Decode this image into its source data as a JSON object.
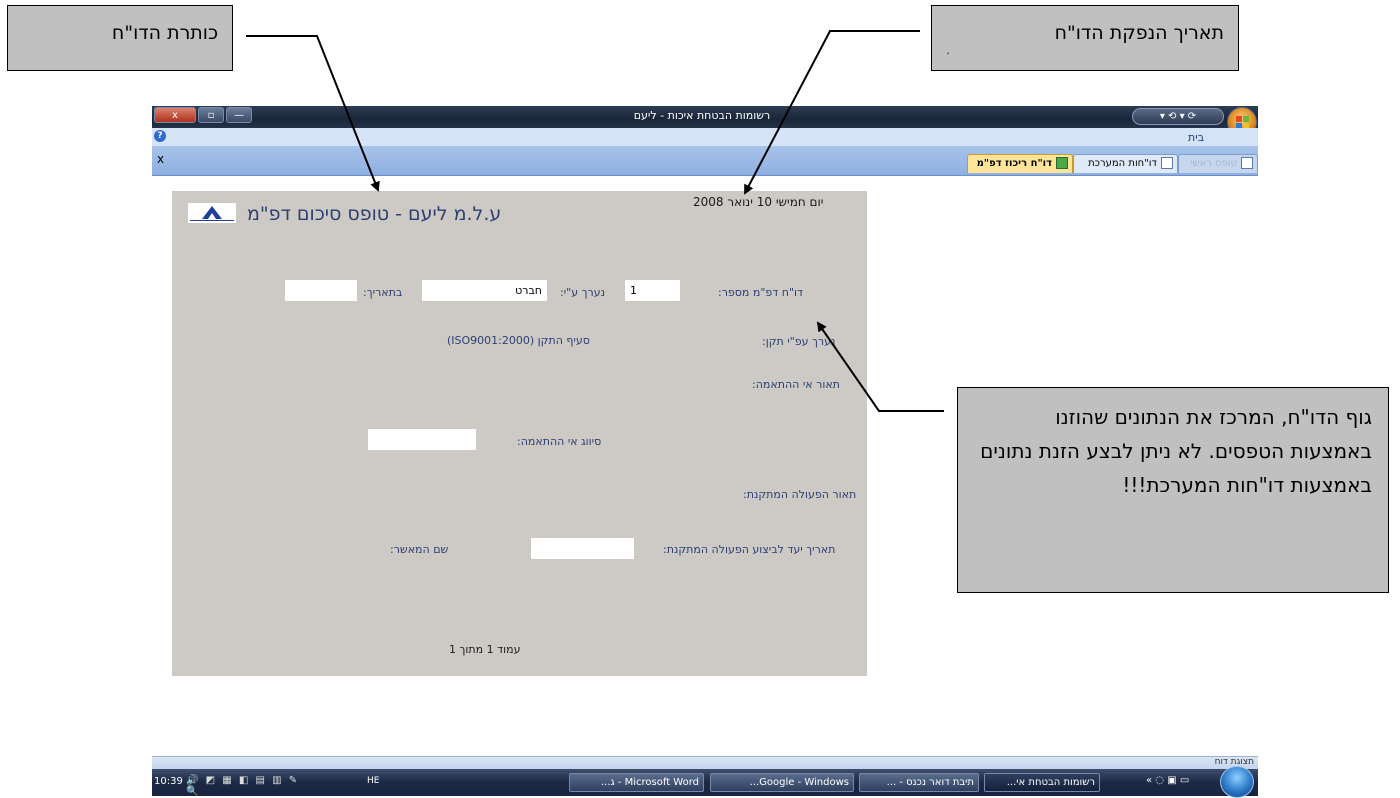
{
  "callouts": {
    "report_title": "כותרת הדו\"ח",
    "issue_date": "תאריך הנפקת הדו\"ח",
    "issue_date_mark": "׳",
    "report_body": "גוף הדו\"ח, המרכז את הנתונים שהוזנו באמצעות הטפסים. לא ניתן לבצע הזנת נתונים באמצעות דו\"חות המערכת!!!"
  },
  "window": {
    "title": "רשומות הבטחת איכות - ליעם",
    "close_label": "x",
    "max_label": "▫",
    "min_label": "—",
    "qat_label": "▾ ⟲ ▾ ⟳",
    "ribbon_tab": "בית",
    "help_label": "?",
    "close_doc": "x"
  },
  "doc_tabs": [
    {
      "label": "דו\"ח ריכוז דפ\"מ",
      "active": true
    },
    {
      "label": "דו\"חות המערכת",
      "active": false
    },
    {
      "label": "טופס ראשי",
      "active": false
    }
  ],
  "report": {
    "date": "יום חמישי 10 ינואר 2008",
    "title": "ע.ל.מ ליעם - טופס סיכום דפ\"מ",
    "report_no_label": "דו\"ח דפ\"מ מספר:",
    "report_no_value": "1",
    "prepared_by_label": "נערך ע\"י:",
    "prepared_by_value": "חברט",
    "on_date_label": "בתאריך:",
    "on_date_value": "",
    "standard_label": "נערך עפ\"י תקן:",
    "standard_value": "סעיף התקן (ISO9001:2000)",
    "nc_desc_label": "תאור אי ההתאמה:",
    "nc_class_label": "סיווג אי ההתאמה:",
    "nc_class_value": "",
    "ca_desc_label": "תאור הפעולה המתקנת:",
    "ca_target_label": "תאריך יעד לביצוע הפעולה המתקנת:",
    "ca_target_value": "",
    "approver_label": "שם המאשר:",
    "page_footer": "עמוד 1 מתוך 1"
  },
  "statusbar": {
    "text": "תצוגת דוח"
  },
  "taskbar": {
    "clock": "10:39",
    "tray": "🔊 ◩ ▦ ◧ ▤ ▥ ✎ 🔍",
    "lang": "HE",
    "quick": "«  ◌ ▣ ▭",
    "buttons": [
      {
        "label": "רשומות הבטחת אי..."
      },
      {
        "label": "תיבת דואר נכנס - ..."
      },
      {
        "label": "Google - Windows..."
      },
      {
        "label": "Microsoft Word - ג..."
      }
    ]
  },
  "colors": {
    "report_bg": "#cdcac5",
    "callout_bg": "#c0c0c0",
    "title_blue": "#2b3f72",
    "active_tab": "#ffe49a"
  }
}
